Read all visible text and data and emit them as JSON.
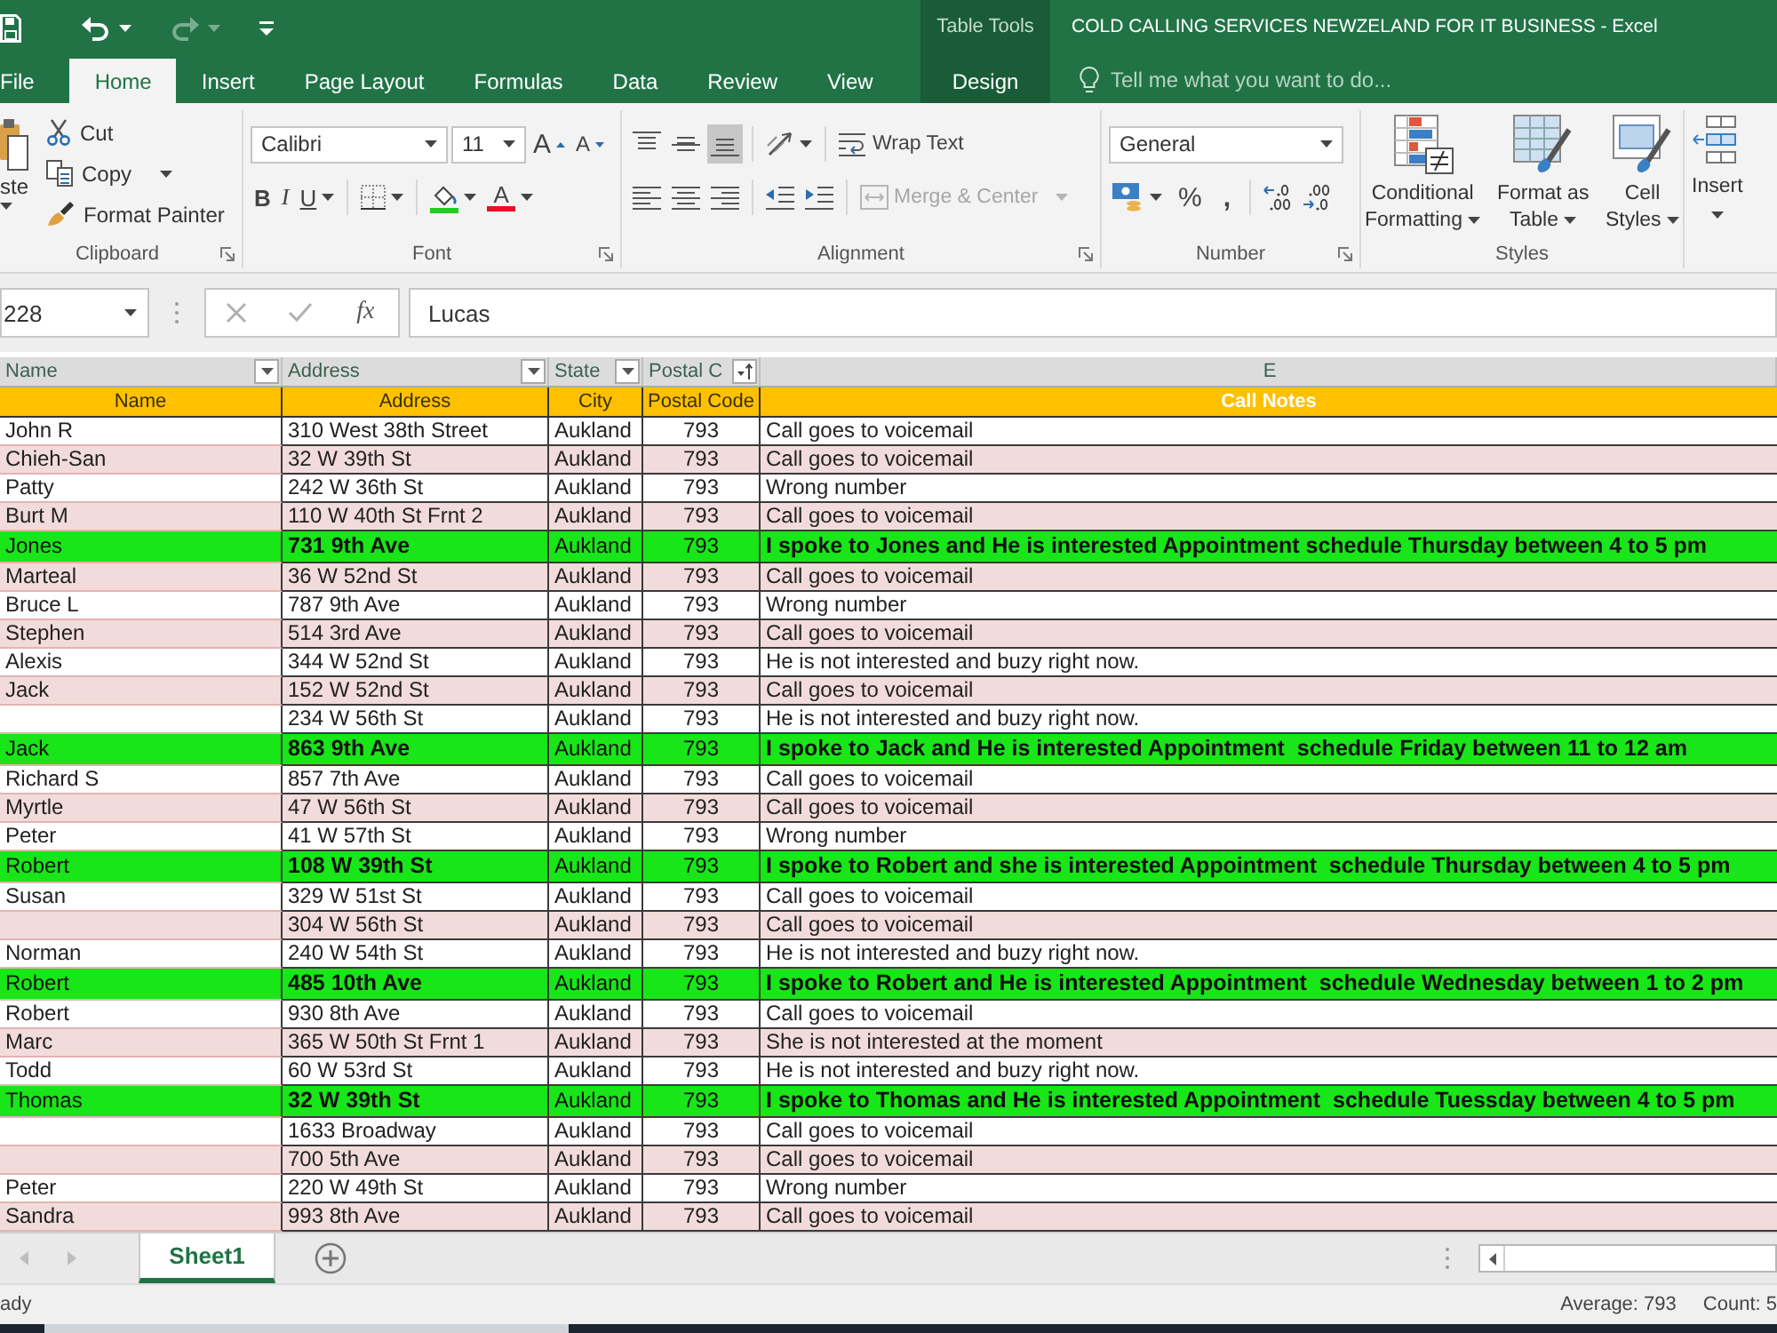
{
  "title_bar": {
    "quick_access": [
      {
        "kind": "save",
        "disabled": false
      },
      {
        "kind": "undo",
        "disabled": false
      },
      {
        "kind": "redo",
        "disabled": true
      },
      {
        "kind": "customize",
        "disabled": false
      }
    ],
    "context_group": "Table Tools",
    "title": "COLD CALLING SERVICES NEWZELAND FOR IT BUSINESS - Excel"
  },
  "ribbon_tabs": [
    {
      "label": "File",
      "selected": false
    },
    {
      "label": "Home",
      "selected": true
    },
    {
      "label": "Insert",
      "selected": false
    },
    {
      "label": "Page Layout",
      "selected": false
    },
    {
      "label": "Formulas",
      "selected": false
    },
    {
      "label": "Data",
      "selected": false
    },
    {
      "label": "Review",
      "selected": false
    },
    {
      "label": "View",
      "selected": false
    }
  ],
  "context_tab": {
    "label": "Design",
    "selected": false
  },
  "tell_me": {
    "placeholder": "Tell me what you want to do..."
  },
  "ribbon": {
    "clipboard": {
      "label": "Clipboard",
      "paste": "ste",
      "commands": [
        {
          "kind": "cut",
          "label": "Cut",
          "dropdown": false
        },
        {
          "kind": "copy",
          "label": "Copy",
          "dropdown": true
        },
        {
          "kind": "format_painter",
          "label": "Format Painter",
          "dropdown": false
        }
      ]
    },
    "font": {
      "label": "Font",
      "font_name": "Calibri",
      "font_size": "11",
      "grow": "A",
      "shrink": "A",
      "styles": [
        {
          "kind": "bold",
          "label": "B"
        },
        {
          "kind": "italic",
          "label": "I"
        },
        {
          "kind": "underline",
          "label": "U"
        }
      ],
      "font_color": "A"
    },
    "alignment": {
      "label": "Alignment",
      "vertical": [
        {
          "kind": "top",
          "selected": false
        },
        {
          "kind": "middle",
          "selected": false
        },
        {
          "kind": "bottom",
          "selected": true
        }
      ],
      "horizontal": [
        {
          "kind": "left",
          "selected": false
        },
        {
          "kind": "center",
          "selected": false
        },
        {
          "kind": "right",
          "selected": false
        }
      ],
      "wrap_text": "Wrap Text",
      "merge": {
        "label": "Merge & Center",
        "disabled": true
      }
    },
    "number": {
      "label": "Number",
      "format": "General",
      "percent": "%",
      "comma": ","
    },
    "styles": {
      "label": "Styles",
      "buttons": [
        {
          "kind": "conditional",
          "lines": [
            "Conditional",
            "Formatting"
          ]
        },
        {
          "kind": "table",
          "lines": [
            "Format as",
            "Table"
          ]
        },
        {
          "kind": "cell",
          "lines": [
            "Cell",
            "Styles"
          ]
        }
      ]
    },
    "cells": {
      "insert": "Insert"
    }
  },
  "formula_bar": {
    "name_box": "228",
    "fx": "fx",
    "formula": "Lucas"
  },
  "sheet": {
    "columns": [
      {
        "label": "Name",
        "filter": true,
        "sorted": false
      },
      {
        "label": "Address",
        "filter": true,
        "sorted": false
      },
      {
        "label": "State",
        "filter": true,
        "sorted": false
      },
      {
        "label": "Postal C",
        "filter": true,
        "sorted": true
      },
      {
        "label": "E",
        "filter": false
      }
    ],
    "header_row": [
      "Name",
      "Address",
      "City",
      "Postal Code",
      "Call Notes"
    ],
    "rows": [
      {
        "name": "John R",
        "address": "310 West 38th Street",
        "city": "Aukland",
        "postal_code": "793",
        "notes": "Call goes to voicemail",
        "highlighted": false
      },
      {
        "name": "Chieh-San",
        "address": "32 W 39th St",
        "city": "Aukland",
        "postal_code": "793",
        "notes": "Call goes to voicemail",
        "highlighted": false
      },
      {
        "name": "Patty",
        "address": "242 W 36th St",
        "city": "Aukland",
        "postal_code": "793",
        "notes": "Wrong number",
        "highlighted": false
      },
      {
        "name": "Burt M",
        "address": "110 W 40th St Frnt 2",
        "city": "Aukland",
        "postal_code": "793",
        "notes": "Call goes to voicemail",
        "highlighted": false
      },
      {
        "name": "Jones",
        "address": "731 9th Ave",
        "city": "Aukland",
        "postal_code": "793",
        "notes": "I spoke to Jones and He is interested Appointment schedule Thursday between 4 to 5 pm",
        "highlighted": true
      },
      {
        "name": "Marteal",
        "address": "36 W 52nd St",
        "city": "Aukland",
        "postal_code": "793",
        "notes": "Call goes to voicemail",
        "highlighted": false
      },
      {
        "name": "Bruce L",
        "address": "787 9th Ave",
        "city": "Aukland",
        "postal_code": "793",
        "notes": "Wrong number",
        "highlighted": false
      },
      {
        "name": "Stephen",
        "address": "514 3rd Ave",
        "city": "Aukland",
        "postal_code": "793",
        "notes": "Call goes to voicemail",
        "highlighted": false
      },
      {
        "name": "Alexis",
        "address": "344 W 52nd St",
        "city": "Aukland",
        "postal_code": "793",
        "notes": "He is not interested and buzy right now.",
        "highlighted": false
      },
      {
        "name": "Jack",
        "address": "152 W 52nd St",
        "city": "Aukland",
        "postal_code": "793",
        "notes": "Call goes to voicemail",
        "highlighted": false
      },
      {
        "address": "234 W 56th St",
        "city": "Aukland",
        "postal_code": "793",
        "notes": "He is not interested and buzy right now.",
        "highlighted": false
      },
      {
        "name": "Jack",
        "address": "863 9th Ave",
        "city": "Aukland",
        "postal_code": "793",
        "notes": "I spoke to Jack and He is interested Appointment  schedule Friday between 11 to 12 am",
        "highlighted": true
      },
      {
        "name": "Richard S",
        "address": "857 7th Ave",
        "city": "Aukland",
        "postal_code": "793",
        "notes": "Call goes to voicemail",
        "highlighted": false
      },
      {
        "name": "Myrtle",
        "address": "47 W 56th St",
        "city": "Aukland",
        "postal_code": "793",
        "notes": "Call goes to voicemail",
        "highlighted": false
      },
      {
        "name": "Peter",
        "address": "41 W 57th St",
        "city": "Aukland",
        "postal_code": "793",
        "notes": "Wrong number",
        "highlighted": false
      },
      {
        "name": "Robert",
        "address": "108 W 39th St",
        "city": "Aukland",
        "postal_code": "793",
        "notes": "I spoke to Robert and she is interested Appointment  schedule Thursday between 4 to 5 pm",
        "highlighted": true
      },
      {
        "name": "Susan",
        "address": "329 W 51st St",
        "city": "Aukland",
        "postal_code": "793",
        "notes": "Call goes to voicemail",
        "highlighted": false
      },
      {
        "address": "304 W 56th St",
        "city": "Aukland",
        "postal_code": "793",
        "notes": "Call goes to voicemail",
        "highlighted": false
      },
      {
        "name": "Norman",
        "address": "240 W 54th St",
        "city": "Aukland",
        "postal_code": "793",
        "notes": "He is not interested and buzy right now.",
        "highlighted": false
      },
      {
        "name": "Robert",
        "address": "485 10th Ave",
        "city": "Aukland",
        "postal_code": "793",
        "notes": "I spoke to Robert and He is interested Appointment  schedule Wednesday between 1 to 2 pm",
        "highlighted": true
      },
      {
        "name": "Robert",
        "address": "930 8th Ave",
        "city": "Aukland",
        "postal_code": "793",
        "notes": "Call goes to voicemail",
        "highlighted": false
      },
      {
        "name": "Marc",
        "address": "365 W 50th St Frnt 1",
        "city": "Aukland",
        "postal_code": "793",
        "notes": "She is not interested at the moment",
        "highlighted": false
      },
      {
        "name": "Todd",
        "address": "60 W 53rd St",
        "city": "Aukland",
        "postal_code": "793",
        "notes": "He is not interested and buzy right now.",
        "highlighted": false
      },
      {
        "name": "Thomas",
        "address": "32 W 39th St",
        "city": "Aukland",
        "postal_code": "793",
        "notes": "I spoke to Thomas and He is interested Appointment  schedule Tuessday between 4 to 5 pm",
        "highlighted": true
      },
      {
        "address": "1633 Broadway",
        "city": "Aukland",
        "postal_code": "793",
        "notes": "Call goes to voicemail",
        "highlighted": false
      },
      {
        "address": "700 5th Ave",
        "city": "Aukland",
        "postal_code": "793",
        "notes": "Call goes to voicemail",
        "highlighted": false
      },
      {
        "name": "Peter",
        "address": "220 W 49th St",
        "city": "Aukland",
        "postal_code": "793",
        "notes": "Wrong number",
        "highlighted": false
      },
      {
        "name": "Sandra",
        "address": "993 8th Ave",
        "city": "Aukland",
        "postal_code": "793",
        "notes": "Call goes to voicemail",
        "highlighted": false
      }
    ]
  },
  "sheet_tabs": [
    {
      "label": "Sheet1",
      "selected": true
    }
  ],
  "status_bar": {
    "mode": "ady",
    "average": "Average: 793",
    "count": "Count: 5"
  }
}
